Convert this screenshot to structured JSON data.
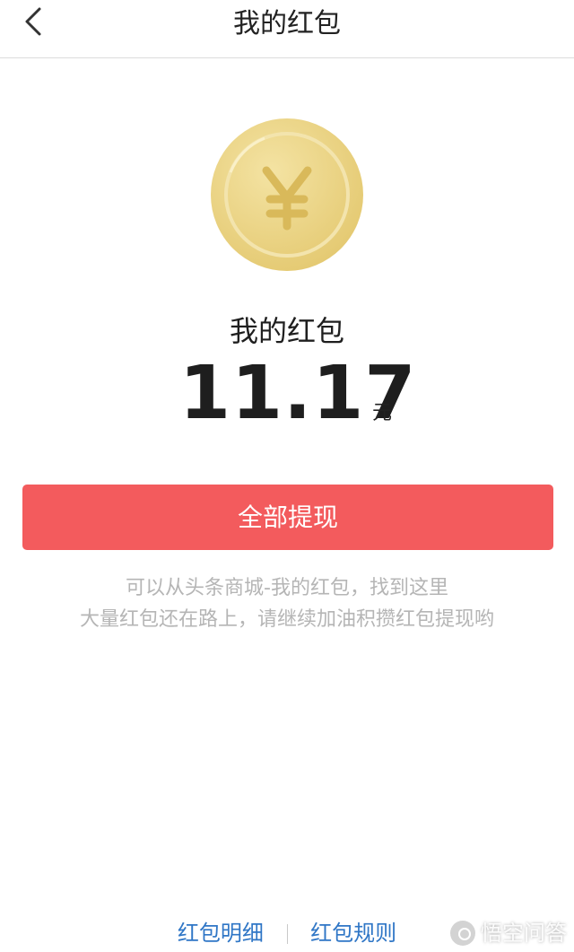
{
  "header": {
    "title": "我的红包",
    "back_icon": "chevron-left-icon"
  },
  "coin": {
    "icon": "yuan-coin-icon",
    "symbol": "¥",
    "color": "#e9d07c"
  },
  "balance": {
    "label": "我的红包",
    "amount": "11.17",
    "unit": "元"
  },
  "withdraw_button": {
    "label": "全部提现",
    "color": "#f35b5d"
  },
  "tips": {
    "line1": "可以从头条商城-我的红包，找到这里",
    "line2": "大量红包还在路上，请继续加油积攒红包提现哟"
  },
  "footer": {
    "details_label": "红包明细",
    "rules_label": "红包规则",
    "link_color": "#2f76c6"
  },
  "watermark": {
    "text": "悟空问答",
    "icon": "wukong-logo-icon"
  }
}
